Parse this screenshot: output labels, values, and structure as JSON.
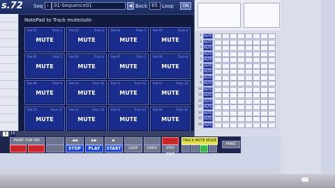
{
  "app": {
    "title": "s.72"
  },
  "toolbar": {
    "seq_label": "Seq",
    "sequence": "01-Sequence01",
    "back_label": "Back",
    "back_value": "65",
    "loop_label": "Loop",
    "loop_state": "ON"
  },
  "panel": {
    "title": "NotePad to Track mute/solo",
    "pads": [
      {
        "pad": "Pad 01",
        "track": "Track 1",
        "label": "MUTE"
      },
      {
        "pad": "Pad 02",
        "track": "Track 2",
        "label": "MUTE"
      },
      {
        "pad": "Pad 03",
        "track": "Track 3",
        "label": "MUTE"
      },
      {
        "pad": "Pad 04",
        "track": "Track 4",
        "label": "MUTE"
      },
      {
        "pad": "Pad 05",
        "track": "Track 5",
        "label": "MUTE"
      },
      {
        "pad": "Pad 06",
        "track": "Track 6",
        "label": "MUTE"
      },
      {
        "pad": "Pad 07",
        "track": "Track 7",
        "label": "MUTE"
      },
      {
        "pad": "Pad 08",
        "track": "Track 8",
        "label": "MUTE"
      },
      {
        "pad": "Pad 09",
        "track": "Track 9",
        "label": "MUTE"
      },
      {
        "pad": "Pad 10",
        "track": "Track 10",
        "label": "MUTE"
      },
      {
        "pad": "Pad 11",
        "track": "Track 11",
        "label": "MUTE"
      },
      {
        "pad": "Pad 12",
        "track": "Track 12",
        "label": "MUTE"
      },
      {
        "pad": "Pad 13",
        "track": "Track 13",
        "label": "MUTE"
      },
      {
        "pad": "Pad 14",
        "track": "Track 14",
        "label": "MUTE"
      },
      {
        "pad": "Pad 15",
        "track": "Track 15",
        "label": "MUTE"
      },
      {
        "pad": "Pad 16",
        "track": "Track 16",
        "label": "MUTE"
      }
    ]
  },
  "strip": {
    "left_value": "1",
    "counter": "14"
  },
  "bottom": {
    "print_label": "PRINT FOR REC",
    "stop": "STOP",
    "play": "PLAY",
    "start": "START",
    "loop": "LOOP",
    "undo": "UNDO",
    "step_edit": "STEP EDIT",
    "track_mute_mode": "TRACK MUTE MODE",
    "panic": "PANIC"
  },
  "table": {
    "mute_label": "MUTE",
    "track_numbers": [
      "1",
      "2",
      "3",
      "4",
      "5",
      "6",
      "7",
      "8",
      "9",
      "10",
      "11",
      "12",
      "13",
      "14",
      "15",
      "16"
    ]
  },
  "colors": {
    "pad_blue": "#1a2d8c",
    "mute_blue": "#1e2d8e",
    "red": "#c8262a",
    "play_blue": "#1f47d6",
    "green": "#38b84a",
    "yellow": "#e1e04e"
  }
}
